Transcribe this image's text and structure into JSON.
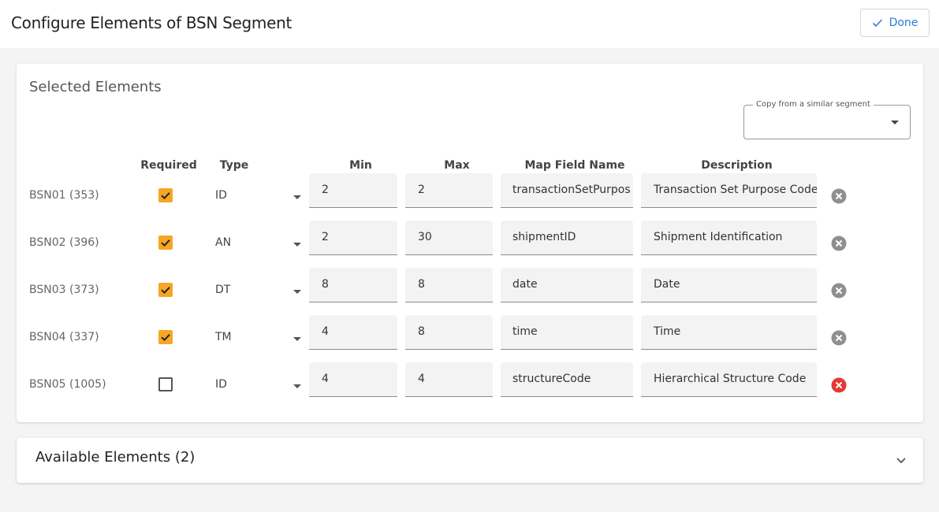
{
  "header": {
    "title": "Configure Elements of BSN Segment",
    "done_label": "Done"
  },
  "selected": {
    "title": "Selected Elements",
    "copy_select": {
      "label": "Copy from a similar segment",
      "value": ""
    },
    "columns": {
      "required": "Required",
      "type": "Type",
      "min": "Min",
      "max": "Max",
      "map_field": "Map Field Name",
      "description": "Description"
    },
    "rows": [
      {
        "label": "BSN01 (353)",
        "required": true,
        "type": "ID",
        "min": "2",
        "max": "2",
        "map_field": "transactionSetPurpos",
        "description": "Transaction Set Purpose Code",
        "remove_color": "#8f8f8f"
      },
      {
        "label": "BSN02 (396)",
        "required": true,
        "type": "AN",
        "min": "2",
        "max": "30",
        "map_field": "shipmentID",
        "description": "Shipment Identification",
        "remove_color": "#8f8f8f"
      },
      {
        "label": "BSN03 (373)",
        "required": true,
        "type": "DT",
        "min": "8",
        "max": "8",
        "map_field": "date",
        "description": "Date",
        "remove_color": "#8f8f8f"
      },
      {
        "label": "BSN04 (337)",
        "required": true,
        "type": "TM",
        "min": "4",
        "max": "8",
        "map_field": "time",
        "description": "Time",
        "remove_color": "#8f8f8f"
      },
      {
        "label": "BSN05 (1005)",
        "required": false,
        "type": "ID",
        "min": "4",
        "max": "4",
        "map_field": "structureCode",
        "description": "Hierarchical Structure Code",
        "remove_color": "#e53935"
      }
    ]
  },
  "available": {
    "title": "Available Elements (2)"
  },
  "colors": {
    "accent": "#2e7dd1",
    "checkbox": "#f6a623",
    "remove_enabled": "#e53935",
    "remove_disabled": "#8f8f8f"
  }
}
